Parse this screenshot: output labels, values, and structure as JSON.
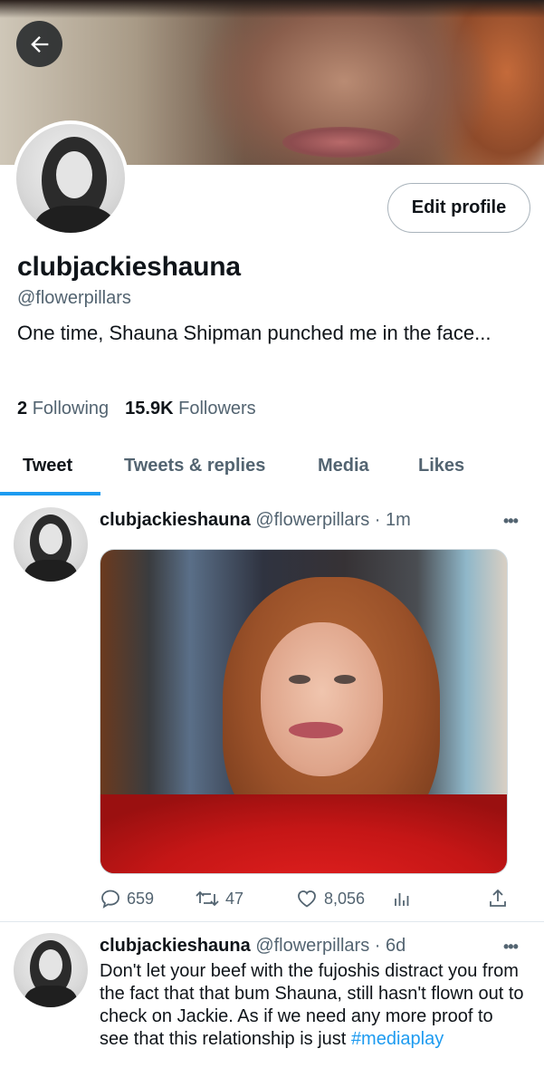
{
  "profile": {
    "display_name": "clubjackieshauna",
    "handle": "@flowerpillars",
    "bio": "One time, Shauna Shipman punched me in the face...",
    "following_count": "2",
    "following_label": "Following",
    "followers_count": "15.9K",
    "followers_label": "Followers",
    "edit_button": "Edit profile"
  },
  "tabs": [
    {
      "label": "Tweet",
      "active": true
    },
    {
      "label": "Tweets & replies",
      "active": false
    },
    {
      "label": "Media",
      "active": false
    },
    {
      "label": "Likes",
      "active": false
    }
  ],
  "tweets": [
    {
      "author": "clubjackieshauna",
      "handle": "@flowerpillars",
      "time": "· 1m",
      "more": "•••",
      "actions": {
        "replies": "659",
        "retweets": "47",
        "likes": "8,056"
      }
    },
    {
      "author": "clubjackieshauna",
      "handle": "@flowerpillars",
      "time": "· 6d",
      "more": "•••",
      "text": "Don't let your beef with the fujoshis distract you from the fact that that bum Shauna, still hasn't flown out to check on Jackie. As if we need any more proof to see that this relationship is just",
      "hashtag": "#mediaplay"
    }
  ],
  "colors": {
    "accent": "#1d9bf0",
    "secondary_text": "#536471",
    "primary_text": "#0f1419"
  },
  "icons": [
    "back-arrow-icon",
    "reply-icon",
    "retweet-icon",
    "like-icon",
    "analytics-icon",
    "share-icon",
    "more-icon"
  ]
}
